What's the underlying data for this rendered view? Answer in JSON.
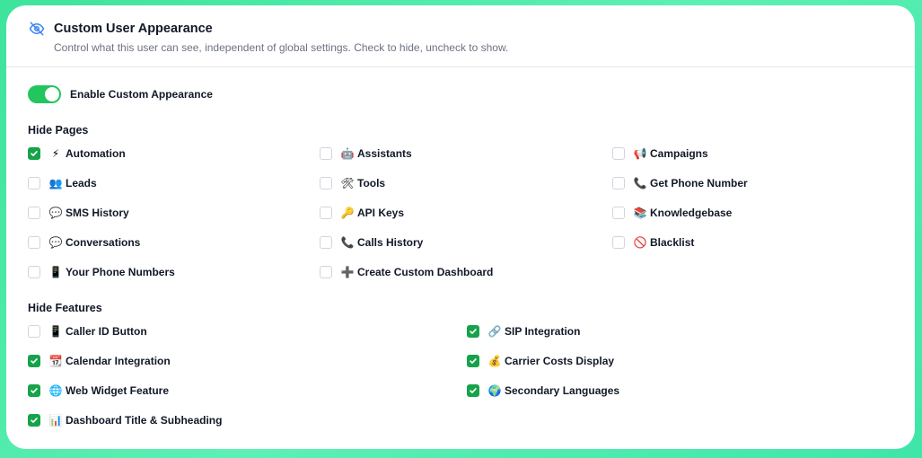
{
  "header": {
    "title": "Custom User Appearance",
    "subtitle": "Control what this user can see, independent of global settings. Check to hide, uncheck to show."
  },
  "toggle": {
    "label": "Enable Custom Appearance",
    "enabled": true
  },
  "colors": {
    "accent": "#22c55e",
    "check": "#16a34a"
  },
  "hide_pages": {
    "title": "Hide Pages",
    "items": [
      {
        "emoji": "⚡",
        "icon": "lightning-icon",
        "label": "Automation",
        "checked": true
      },
      {
        "emoji": "🤖",
        "icon": "robot-icon",
        "label": "Assistants",
        "checked": false
      },
      {
        "emoji": "📢",
        "icon": "megaphone-icon",
        "label": "Campaigns",
        "checked": false
      },
      {
        "emoji": "👥",
        "icon": "people-icon",
        "label": "Leads",
        "checked": false
      },
      {
        "emoji": "🛠",
        "icon": "tools-icon",
        "label": "Tools",
        "checked": false
      },
      {
        "emoji": "📞",
        "icon": "phone-icon",
        "label": "Get Phone Number",
        "checked": false
      },
      {
        "emoji": "💬",
        "icon": "speech-bubble-icon",
        "label": "SMS History",
        "checked": false
      },
      {
        "emoji": "🔑",
        "icon": "key-icon",
        "label": "API Keys",
        "checked": false
      },
      {
        "emoji": "📚",
        "icon": "books-icon",
        "label": "Knowledgebase",
        "checked": false
      },
      {
        "emoji": "💬",
        "icon": "speech-bubble-icon",
        "label": "Conversations",
        "checked": false
      },
      {
        "emoji": "📞",
        "icon": "phone-icon",
        "label": "Calls History",
        "checked": false
      },
      {
        "emoji": "🚫",
        "icon": "prohibited-icon",
        "label": "Blacklist",
        "checked": false
      },
      {
        "emoji": "📱",
        "icon": "mobile-phone-icon",
        "label": "Your Phone Numbers",
        "checked": false
      },
      {
        "emoji": "➕",
        "icon": "plus-icon",
        "label": "Create Custom Dashboard",
        "checked": false
      }
    ]
  },
  "hide_features": {
    "title": "Hide Features",
    "items": [
      {
        "emoji": "📱",
        "icon": "mobile-phone-icon",
        "label": "Caller ID Button",
        "checked": false
      },
      {
        "emoji": "🔗",
        "icon": "link-icon",
        "label": "SIP Integration",
        "checked": true
      },
      {
        "emoji": "📆",
        "icon": "calendar-icon",
        "label": "Calendar Integration",
        "checked": true
      },
      {
        "emoji": "💰",
        "icon": "money-bag-icon",
        "label": "Carrier Costs Display",
        "checked": true
      },
      {
        "emoji": "🌐",
        "icon": "globe-icon",
        "label": "Web Widget Feature",
        "checked": true
      },
      {
        "emoji": "🌍",
        "icon": "earth-icon",
        "label": "Secondary Languages",
        "checked": true
      },
      {
        "emoji": "📊",
        "icon": "bar-chart-icon",
        "label": "Dashboard Title & Subheading",
        "checked": true
      }
    ]
  }
}
